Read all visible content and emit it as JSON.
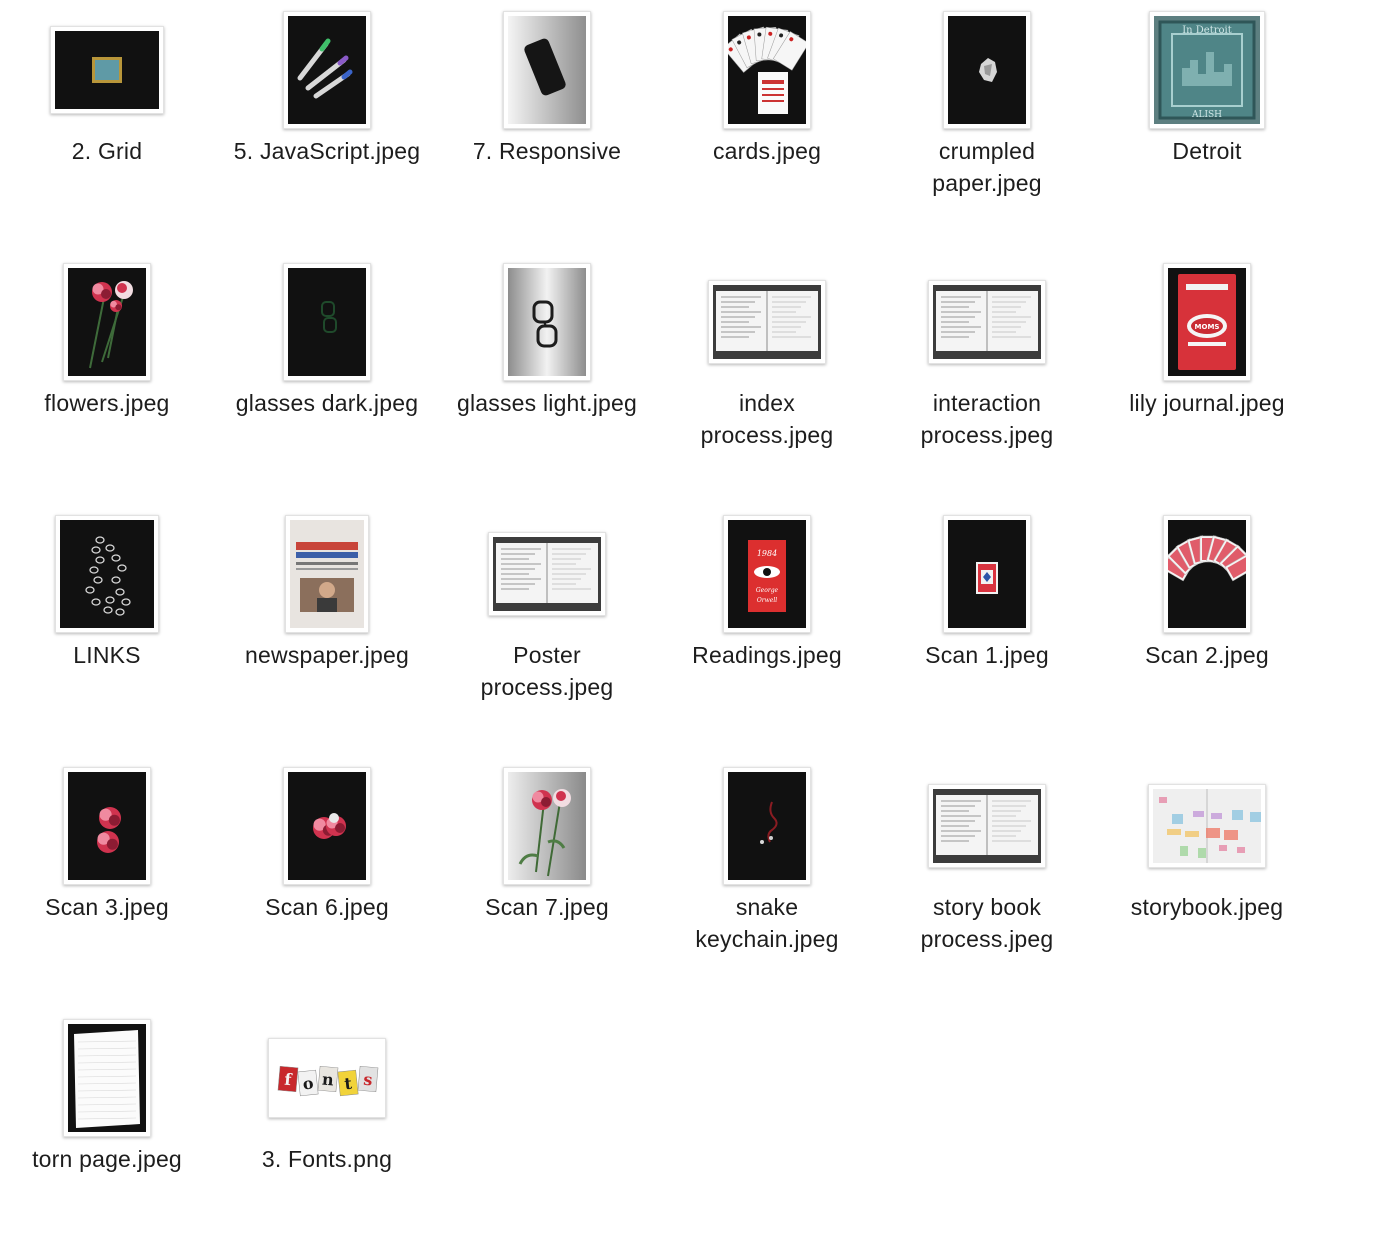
{
  "files": [
    {
      "name": "2. Grid",
      "lines": [
        "2. Grid"
      ],
      "thumb": "landscape-dark",
      "icon": "blue-tile-photo-icon"
    },
    {
      "name": "5. JavaScript.jpeg",
      "lines": [
        "5. JavaScript.jpeg"
      ],
      "thumb": "portrait-dark",
      "icon": "markers-photo-icon"
    },
    {
      "name": "7. Responsive",
      "lines": [
        "7. Responsive"
      ],
      "thumb": "portrait-gray",
      "icon": "phone-photo-icon"
    },
    {
      "name": "cards.jpeg",
      "lines": [
        "cards.jpeg"
      ],
      "thumb": "portrait-dark",
      "icon": "playing-cards-photo-icon"
    },
    {
      "name": "crumpled paper.jpeg",
      "lines": [
        "crumpled",
        "paper.jpeg"
      ],
      "thumb": "portrait-dark",
      "icon": "crumpled-paper-photo-icon"
    },
    {
      "name": "Detroit",
      "lines": [
        "Detroit"
      ],
      "thumb": "square-teal",
      "icon": "detroit-tile-photo-icon"
    },
    {
      "name": "flowers.jpeg",
      "lines": [
        "flowers.jpeg"
      ],
      "thumb": "portrait-dark",
      "icon": "flowers-photo-icon"
    },
    {
      "name": "glasses dark.jpeg",
      "lines": [
        "glasses dark.jpeg"
      ],
      "thumb": "portrait-dark",
      "icon": "glasses-dark-photo-icon"
    },
    {
      "name": "glasses light.jpeg",
      "lines": [
        "glasses light.jpeg"
      ],
      "thumb": "portrait-gray",
      "icon": "glasses-light-photo-icon"
    },
    {
      "name": "index process.jpeg",
      "lines": [
        "index",
        "process.jpeg"
      ],
      "thumb": "landscape-notebook",
      "icon": "notebook-photo-icon"
    },
    {
      "name": "interaction process.jpeg",
      "lines": [
        "interaction",
        "process.jpeg"
      ],
      "thumb": "landscape-notebook",
      "icon": "notebook-photo-icon"
    },
    {
      "name": "lily journal.jpeg",
      "lines": [
        "lily journal.jpeg"
      ],
      "thumb": "portrait-dark",
      "icon": "red-journal-photo-icon"
    },
    {
      "name": "LINKS",
      "lines": [
        "LINKS"
      ],
      "thumb": "portrait-dark-wide",
      "icon": "chain-photo-icon"
    },
    {
      "name": "newspaper.jpeg",
      "lines": [
        "newspaper.jpeg"
      ],
      "thumb": "portrait-light",
      "icon": "newspaper-photo-icon"
    },
    {
      "name": "Poster process.jpeg",
      "lines": [
        "Poster",
        "process.jpeg"
      ],
      "thumb": "landscape-notebook",
      "icon": "notebook-photo-icon"
    },
    {
      "name": "Readings.jpeg",
      "lines": [
        "Readings.jpeg"
      ],
      "thumb": "portrait-dark",
      "icon": "book-1984-photo-icon"
    },
    {
      "name": "Scan 1.jpeg",
      "lines": [
        "Scan 1.jpeg"
      ],
      "thumb": "portrait-dark",
      "icon": "card-deck-photo-icon"
    },
    {
      "name": "Scan 2.jpeg",
      "lines": [
        "Scan 2.jpeg"
      ],
      "thumb": "portrait-dark",
      "icon": "card-fan-photo-icon"
    },
    {
      "name": "Scan 3.jpeg",
      "lines": [
        "Scan 3.jpeg"
      ],
      "thumb": "portrait-dark",
      "icon": "carnations-photo-icon"
    },
    {
      "name": "Scan 6.jpeg",
      "lines": [
        "Scan 6.jpeg"
      ],
      "thumb": "portrait-dark",
      "icon": "carnations-photo-icon"
    },
    {
      "name": "Scan 7.jpeg",
      "lines": [
        "Scan 7.jpeg"
      ],
      "thumb": "portrait-gray",
      "icon": "flower-stems-photo-icon"
    },
    {
      "name": "snake keychain.jpeg",
      "lines": [
        "snake",
        "keychain.jpeg"
      ],
      "thumb": "portrait-dark",
      "icon": "keychain-photo-icon"
    },
    {
      "name": "story book process.jpeg",
      "lines": [
        "story book",
        "process.jpeg"
      ],
      "thumb": "landscape-notebook",
      "icon": "notebook-photo-icon"
    },
    {
      "name": "storybook.jpeg",
      "lines": [
        "storybook.jpeg"
      ],
      "thumb": "landscape-map",
      "icon": "storybook-map-photo-icon"
    },
    {
      "name": "torn page.jpeg",
      "lines": [
        "torn page.jpeg"
      ],
      "thumb": "portrait-dark",
      "icon": "torn-page-photo-icon"
    },
    {
      "name": "3. Fonts.png",
      "lines": [
        "3. Fonts.png"
      ],
      "thumb": "landscape-white",
      "icon": "fonts-collage-image-icon",
      "art_text": "fonts"
    }
  ],
  "colors": {
    "dark_bg": "#111111",
    "carnation": "#d0334f",
    "card_red": "#d9333f",
    "tile_teal": "#4f8587"
  }
}
